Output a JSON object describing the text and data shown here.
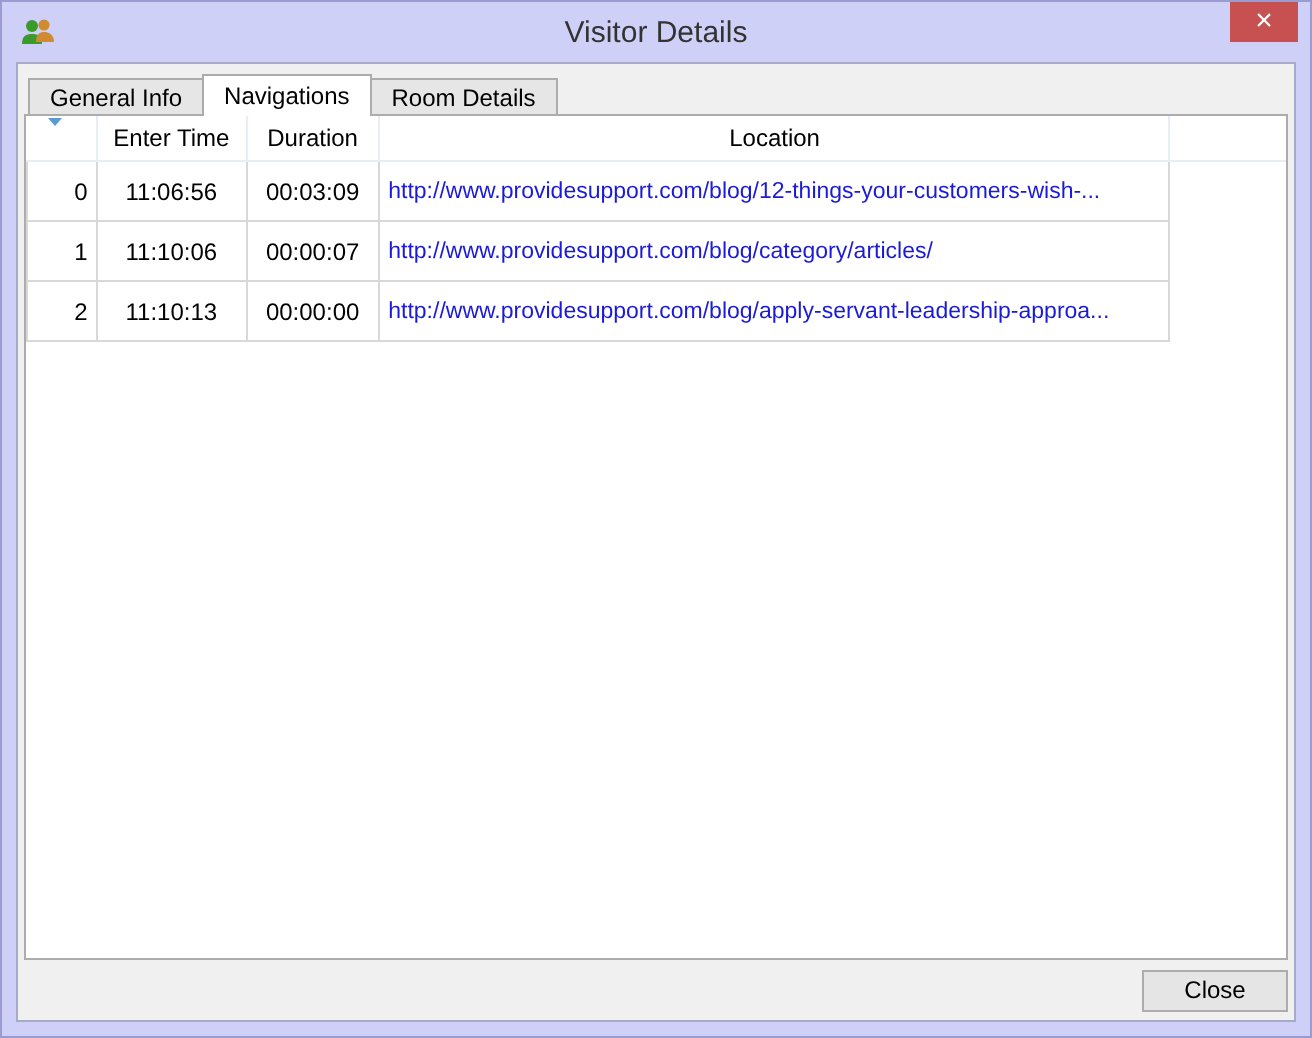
{
  "window": {
    "title": "Visitor Details",
    "close": "×"
  },
  "tabs": [
    {
      "label": "General Info",
      "selected": false
    },
    {
      "label": "Navigations",
      "selected": true
    },
    {
      "label": "Room Details",
      "selected": false
    }
  ],
  "table": {
    "columns": [
      "",
      "Enter Time",
      "Duration",
      "Location"
    ],
    "rows": [
      {
        "index": "0",
        "enter_time": "11:06:56",
        "duration": "00:03:09",
        "location": "http://www.providesupport.com/blog/12-things-your-customers-wish-..."
      },
      {
        "index": "1",
        "enter_time": "11:10:06",
        "duration": "00:00:07",
        "location": "http://www.providesupport.com/blog/category/articles/"
      },
      {
        "index": "2",
        "enter_time": "11:10:13",
        "duration": "00:00:00",
        "location": "http://www.providesupport.com/blog/apply-servant-leadership-approa..."
      }
    ]
  },
  "buttons": [
    "Close"
  ]
}
